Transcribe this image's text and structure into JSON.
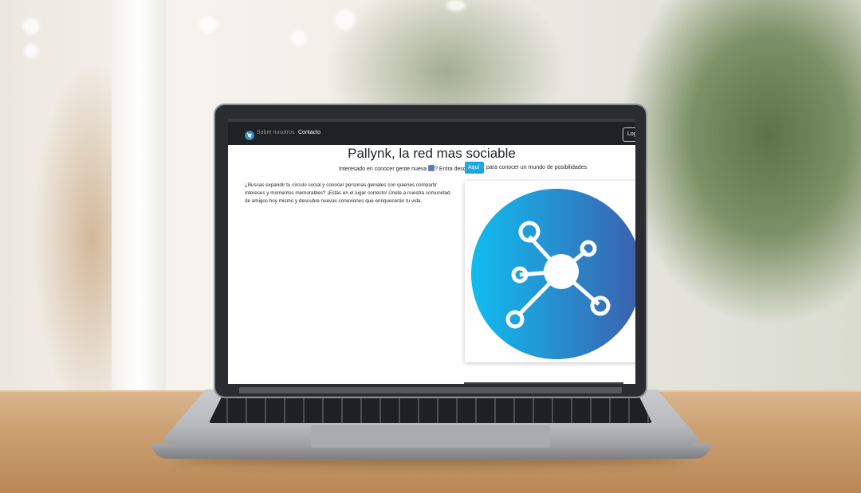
{
  "navbar": {
    "logo_icon": "network-logo-icon",
    "links": [
      "Sobre nosotros",
      "Contacto"
    ],
    "login_label": "Log"
  },
  "hero": {
    "title": "Pallynk, la red mas sociable",
    "subtitle_before": "Interesado en conocer gente nueva",
    "subtitle_mid": "? Entra desde",
    "button_label": "Aquí",
    "subtitle_after": "para conocer un mundo de posibilidades"
  },
  "content": {
    "paragraph": "¿Buscas expandir tu círculo social y conocer personas geniales con quienes compartir intereses y momentos memorables? ¡Estás en el lugar correcto! Únete a nuestra comunidad de amigos hoy mismo y descubre nuevas conexiones que enriquecerán tu vida.",
    "image_icon": "social-network-icon"
  },
  "colors": {
    "accent": "#1da7e6",
    "navbar": "#202124",
    "gradient_start": "#10bdf0",
    "gradient_end": "#3d5fad"
  }
}
